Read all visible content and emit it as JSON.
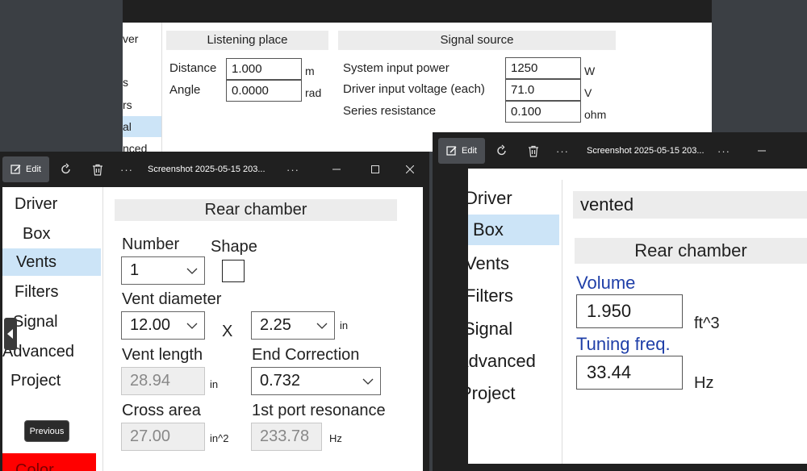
{
  "top_window": {
    "sidebar_fragments": [
      "ver",
      "s",
      "rs",
      "al",
      "nced"
    ],
    "listening_place": {
      "header": "Listening place",
      "distance_label": "Distance",
      "distance_value": "1.000",
      "distance_unit": "m",
      "angle_label": "Angle",
      "angle_value": "0.0000",
      "angle_unit": "rad"
    },
    "signal_source": {
      "header": "Signal source",
      "power_label": "System input power",
      "power_value": "1250",
      "power_unit": "W",
      "voltage_label": "Driver input voltage (each)",
      "voltage_value": "71.0",
      "voltage_unit": "V",
      "resistance_label": "Series resistance",
      "resistance_value": "0.100",
      "resistance_unit": "ohm"
    }
  },
  "left_window": {
    "toolbar": {
      "edit_label": "Edit",
      "title": "Screenshot 2025-05-15 203...",
      "more": "···"
    },
    "sidebar": [
      "Driver",
      "Box",
      "Vents",
      "Filters",
      "Signal",
      "Advanced",
      "Project"
    ],
    "selected": "Vents",
    "rear_chamber_header": "Rear chamber",
    "number_label": "Number",
    "number_value": "1",
    "shape_label": "Shape",
    "vent_diameter_label": "Vent diameter",
    "vent_diameter_value": "12.00",
    "x_label": "X",
    "diameter2_value": "2.25",
    "diameter_unit": "in",
    "vent_length_label": "Vent length",
    "vent_length_value": "28.94",
    "vent_length_unit": "in",
    "end_correction_label": "End Correction",
    "end_correction_value": "0.732",
    "cross_area_label": "Cross area",
    "cross_area_value": "27.00",
    "cross_area_unit": "in^2",
    "port_res_label": "1st port resonance",
    "port_res_value": "233.78",
    "port_res_unit": "Hz",
    "tooltip": "Previous",
    "color_label": "Color",
    "color_swatch": "#ff0000"
  },
  "right_window": {
    "toolbar": {
      "edit_label": "Edit",
      "title": "Screenshot 2025-05-15 203...",
      "more": "···"
    },
    "sidebar": [
      "Driver",
      "Box",
      "Vents",
      "Filters",
      "Signal",
      "Advanced",
      "Project"
    ],
    "selected": "Box",
    "box_type": "vented",
    "rear_chamber_header": "Rear chamber",
    "volume_label": "Volume",
    "volume_value": "1.950",
    "volume_unit": "ft^3",
    "tuning_label": "Tuning freq.",
    "tuning_value": "33.44",
    "tuning_unit": "Hz"
  },
  "colors": {
    "selection": "#cce4f7",
    "titlebar": "#202020",
    "accent_label": "#1f3fa8"
  }
}
